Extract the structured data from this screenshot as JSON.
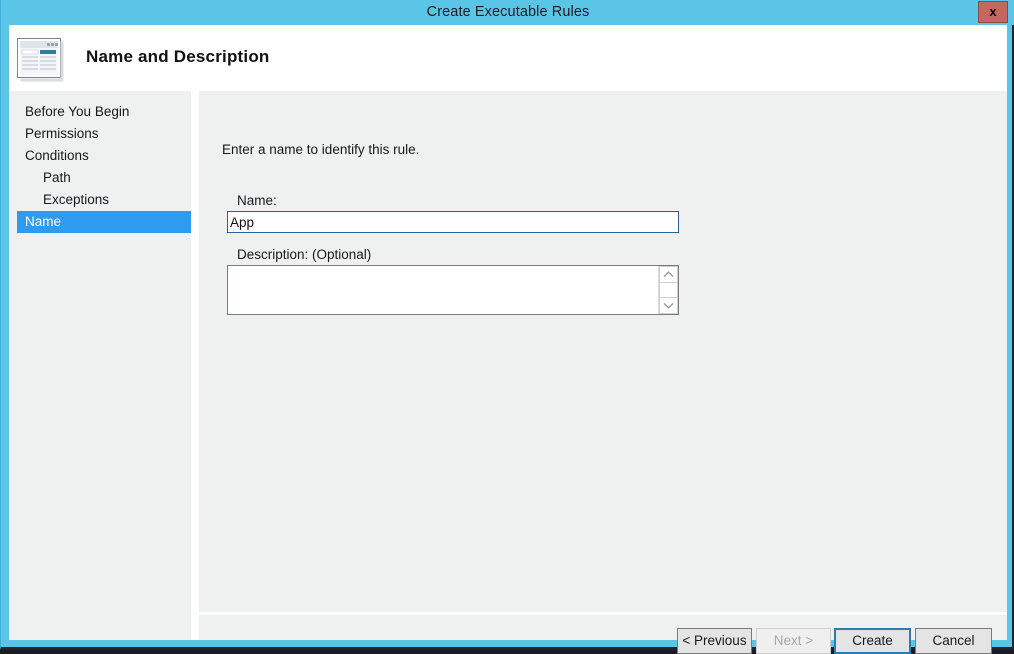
{
  "window": {
    "title": "Create Executable Rules",
    "close_label": "x",
    "accent_color": "#5bc5e8",
    "selection_color": "#2e9bf0",
    "close_button_color": "#c4685f"
  },
  "header": {
    "title": "Name and Description",
    "icon": "wizard-page-icon"
  },
  "sidebar": {
    "items": [
      {
        "label": "Before You Begin",
        "indent": false,
        "selected": false
      },
      {
        "label": "Permissions",
        "indent": false,
        "selected": false
      },
      {
        "label": "Conditions",
        "indent": false,
        "selected": false
      },
      {
        "label": "Path",
        "indent": true,
        "selected": false
      },
      {
        "label": "Exceptions",
        "indent": true,
        "selected": false
      },
      {
        "label": "Name",
        "indent": false,
        "selected": true
      }
    ]
  },
  "main": {
    "instruction": "Enter a name to identify this rule.",
    "name": {
      "label": "Name:",
      "value": "App",
      "placeholder": ""
    },
    "description": {
      "label": "Description: (Optional)",
      "value": "",
      "placeholder": "",
      "scrollbar": {
        "up_icon": "chevron-up-icon",
        "down_icon": "chevron-down-icon"
      }
    }
  },
  "footer": {
    "buttons": [
      {
        "label": "< Previous",
        "state": "enabled"
      },
      {
        "label": "Next >",
        "state": "disabled"
      },
      {
        "label": "Create",
        "state": "focused"
      },
      {
        "label": "Cancel",
        "state": "enabled"
      }
    ]
  }
}
